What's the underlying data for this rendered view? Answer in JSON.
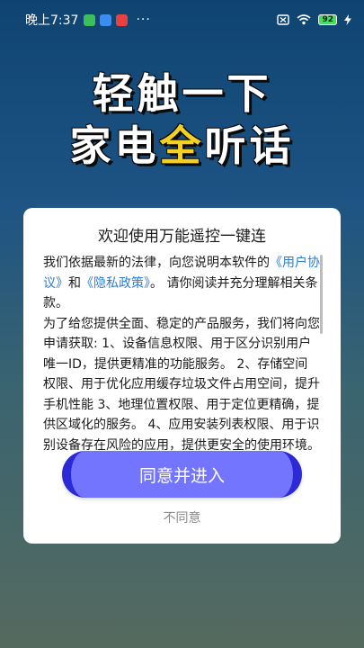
{
  "status_bar": {
    "time": "晚上7:37",
    "overflow": "···",
    "battery": "92",
    "icons": [
      "app-badge-green",
      "app-badge-blue",
      "app-badge-red",
      "sim-x-icon",
      "wifi-icon",
      "battery-icon",
      "charging-icon"
    ]
  },
  "banner": {
    "line1": "轻触一下",
    "line2_prefix": "家电",
    "line2_highlight": "全",
    "line2_suffix": "听话",
    "highlight_color": "#f4cf24"
  },
  "dialog": {
    "title": "欢迎使用万能遥控一键连",
    "para1_a": "我们依据最新的法律，向您说明本软件的",
    "link_user_agreement": "《用户协议》",
    "para1_b": "和",
    "link_privacy": "《隐私政策》",
    "para1_c": "。 请你阅读并充分理解相关条款。",
    "para2": "为了给您提供全面、稳定的产品服务，我们将向您申请获取: 1、设备信息权限、用于区分识别用户唯一ID，提供更精准的功能服务。 2、存储空间权限、用于优化应用缓存垃圾文件占用空间，提升手机性能 3、地理位置权限、用于定位更精确，提供区域化的服务。 4、应用安装列表权限、用于识别设备存在风险的应用，提供更安全的使用环境。",
    "agree_label": "同意并进入",
    "disagree_label": "不同意",
    "accent_color": "#7475ff"
  }
}
